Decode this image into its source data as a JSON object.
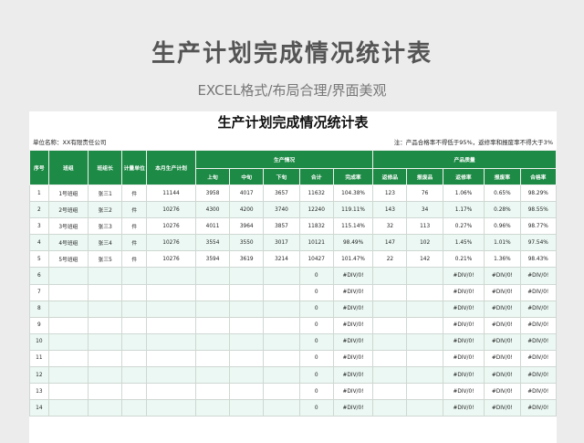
{
  "hero": {
    "title": "生产计划完成情况统计表",
    "subtitle": "EXCEL格式/布局合理/界面美观"
  },
  "sheet": {
    "title": "生产计划完成情况统计表",
    "unit_label": "单位名称：XX有限责任公司",
    "note": "注：产品合格率不得低于95%，返修率和报废率不得大于3%"
  },
  "table": {
    "headers_row1": {
      "seq": "序号",
      "team": "班组",
      "leader": "班组长",
      "unit": "计量单位",
      "plan": "本月生产计划",
      "production": "生产情况",
      "quality": "产品质量"
    },
    "headers_row2": [
      "上旬",
      "中旬",
      "下旬",
      "合计",
      "完成率",
      "返修品",
      "报废品",
      "返修率",
      "报废率",
      "合格率"
    ],
    "rows": [
      [
        "1",
        "1号班组",
        "张三1",
        "件",
        "11144",
        "3958",
        "4017",
        "3657",
        "11632",
        "104.38%",
        "123",
        "76",
        "1.06%",
        "0.65%",
        "98.29%"
      ],
      [
        "2",
        "2号班组",
        "张三2",
        "件",
        "10276",
        "4300",
        "4200",
        "3740",
        "12240",
        "119.11%",
        "143",
        "34",
        "1.17%",
        "0.28%",
        "98.55%"
      ],
      [
        "3",
        "3号班组",
        "张三3",
        "件",
        "10276",
        "4011",
        "3964",
        "3857",
        "11832",
        "115.14%",
        "32",
        "113",
        "0.27%",
        "0.96%",
        "98.77%"
      ],
      [
        "4",
        "4号班组",
        "张三4",
        "件",
        "10276",
        "3554",
        "3550",
        "3017",
        "10121",
        "98.49%",
        "147",
        "102",
        "1.45%",
        "1.01%",
        "97.54%"
      ],
      [
        "5",
        "5号班组",
        "张三5",
        "件",
        "10276",
        "3594",
        "3619",
        "3214",
        "10427",
        "101.47%",
        "22",
        "142",
        "0.21%",
        "1.36%",
        "98.43%"
      ],
      [
        "6",
        "",
        "",
        "",
        "",
        "",
        "",
        "",
        "0",
        "#DIV/0!",
        "",
        "",
        "#DIV/0!",
        "#DIV/0!",
        "#DIV/0!"
      ],
      [
        "7",
        "",
        "",
        "",
        "",
        "",
        "",
        "",
        "0",
        "#DIV/0!",
        "",
        "",
        "#DIV/0!",
        "#DIV/0!",
        "#DIV/0!"
      ],
      [
        "8",
        "",
        "",
        "",
        "",
        "",
        "",
        "",
        "0",
        "#DIV/0!",
        "",
        "",
        "#DIV/0!",
        "#DIV/0!",
        "#DIV/0!"
      ],
      [
        "9",
        "",
        "",
        "",
        "",
        "",
        "",
        "",
        "0",
        "#DIV/0!",
        "",
        "",
        "#DIV/0!",
        "#DIV/0!",
        "#DIV/0!"
      ],
      [
        "10",
        "",
        "",
        "",
        "",
        "",
        "",
        "",
        "0",
        "#DIV/0!",
        "",
        "",
        "#DIV/0!",
        "#DIV/0!",
        "#DIV/0!"
      ],
      [
        "11",
        "",
        "",
        "",
        "",
        "",
        "",
        "",
        "0",
        "#DIV/0!",
        "",
        "",
        "#DIV/0!",
        "#DIV/0!",
        "#DIV/0!"
      ],
      [
        "12",
        "",
        "",
        "",
        "",
        "",
        "",
        "",
        "0",
        "#DIV/0!",
        "",
        "",
        "#DIV/0!",
        "#DIV/0!",
        "#DIV/0!"
      ],
      [
        "13",
        "",
        "",
        "",
        "",
        "",
        "",
        "",
        "0",
        "#DIV/0!",
        "",
        "",
        "#DIV/0!",
        "#DIV/0!",
        "#DIV/0!"
      ],
      [
        "14",
        "",
        "",
        "",
        "",
        "",
        "",
        "",
        "0",
        "#DIV/0!",
        "",
        "",
        "#DIV/0!",
        "#DIV/0!",
        "#DIV/0!"
      ]
    ]
  },
  "colors": {
    "header_green": "#1d8a45",
    "stripe": "#ecf8f3"
  }
}
